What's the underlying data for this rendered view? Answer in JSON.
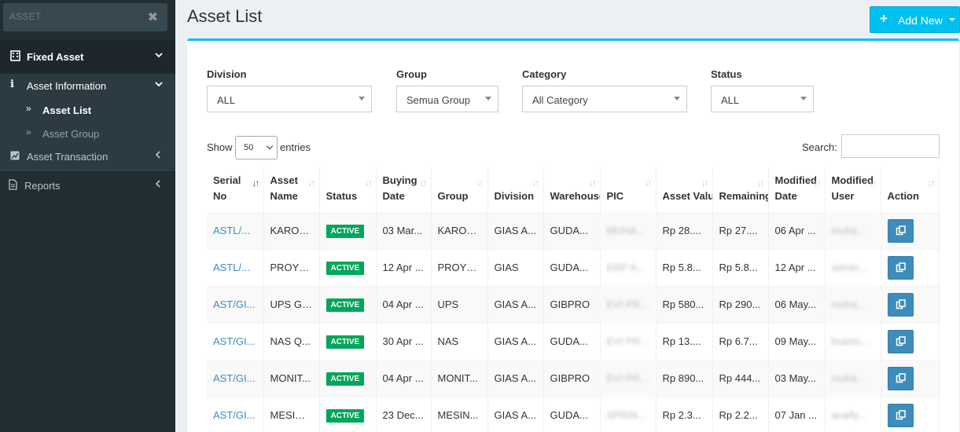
{
  "sidebar": {
    "search_text": "ASSET",
    "fixed_asset": "Fixed Asset",
    "asset_information": "Asset Information",
    "asset_list": "Asset List",
    "asset_group": "Asset Group",
    "asset_transaction": "Asset Transaction",
    "reports": "Reports"
  },
  "header": {
    "title": "Asset List",
    "add_new": "Add New"
  },
  "filters": {
    "division": {
      "label": "Division",
      "value": "ALL"
    },
    "group": {
      "label": "Group",
      "value": "Semua Group"
    },
    "category": {
      "label": "Category",
      "value": "All Category"
    },
    "status": {
      "label": "Status",
      "value": "ALL"
    }
  },
  "table_controls": {
    "show": "Show",
    "entries_value": "50",
    "entries": "entries",
    "search": "Search:"
  },
  "table": {
    "headers": [
      "Serial No",
      "Asset Name",
      "Status",
      "Buying Date",
      "Group",
      "Division",
      "Warehouse",
      "PIC",
      "Asset Value",
      "Remaining",
      "Modified Date",
      "Modified User",
      "Action"
    ],
    "rows": [
      [
        "ASTL/...",
        "KAROS...",
        "ACTIVE",
        "03 Mar...",
        "KAROS...",
        "GIAS A...",
        "GUDA...",
        "MUHA...",
        "Rp 28....",
        "Rp 27....",
        "06 Apr ...",
        "muha...",
        ""
      ],
      [
        "ASTL/...",
        "PROYE...",
        "ACTIVE",
        "12 Apr ...",
        "PROYE...",
        "GIAS",
        "GUDA...",
        "ERP A...",
        "Rp 5.8...",
        "Rp 5.8...",
        "12 Apr ...",
        "admin...",
        ""
      ],
      [
        "AST/GI...",
        "UPS GI...",
        "ACTIVE",
        "04 Apr ...",
        "UPS",
        "GIAS A...",
        "GIBPRO",
        "EVI PR...",
        "Rp 580...",
        "Rp 290...",
        "06 May...",
        "muha...",
        ""
      ],
      [
        "AST/GI...",
        "NAS Q...",
        "ACTIVE",
        "30 Apr ...",
        "NAS",
        "GIAS A...",
        "GUDA...",
        "EVI PR...",
        "Rp 13....",
        "Rp 6.7...",
        "09 May...",
        "bramo...",
        ""
      ],
      [
        "AST/GI...",
        "MONIT...",
        "ACTIVE",
        "04 Apr ...",
        "MONIT...",
        "GIAS A...",
        "GIBPRO",
        "EVI PR...",
        "Rp 890...",
        "Rp 444...",
        "03 May...",
        "muha...",
        ""
      ],
      [
        "AST/GI...",
        "MESIN ...",
        "ACTIVE",
        "23 Dec...",
        "MESIN...",
        "GIAS A...",
        "GUDA...",
        "SPRIN...",
        "Rp 2.3...",
        "Rp 2.2...",
        "07 Jan ...",
        "anafly...",
        ""
      ]
    ]
  }
}
